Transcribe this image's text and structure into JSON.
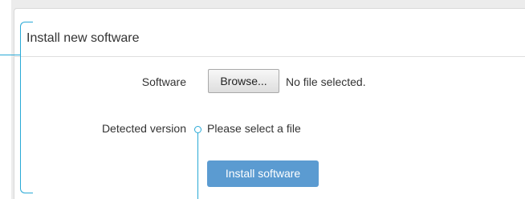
{
  "section": {
    "title": "Install new software"
  },
  "software_row": {
    "label": "Software",
    "browse_button_label": "Browse...",
    "file_status": "No file selected."
  },
  "version_row": {
    "label": "Detected version",
    "value": "Please select a file"
  },
  "actions": {
    "install_button_label": "Install software"
  },
  "colors": {
    "accent_button": "#5b9bd1",
    "callout": "#29a9d6",
    "panel_border": "#d9d9d9"
  }
}
